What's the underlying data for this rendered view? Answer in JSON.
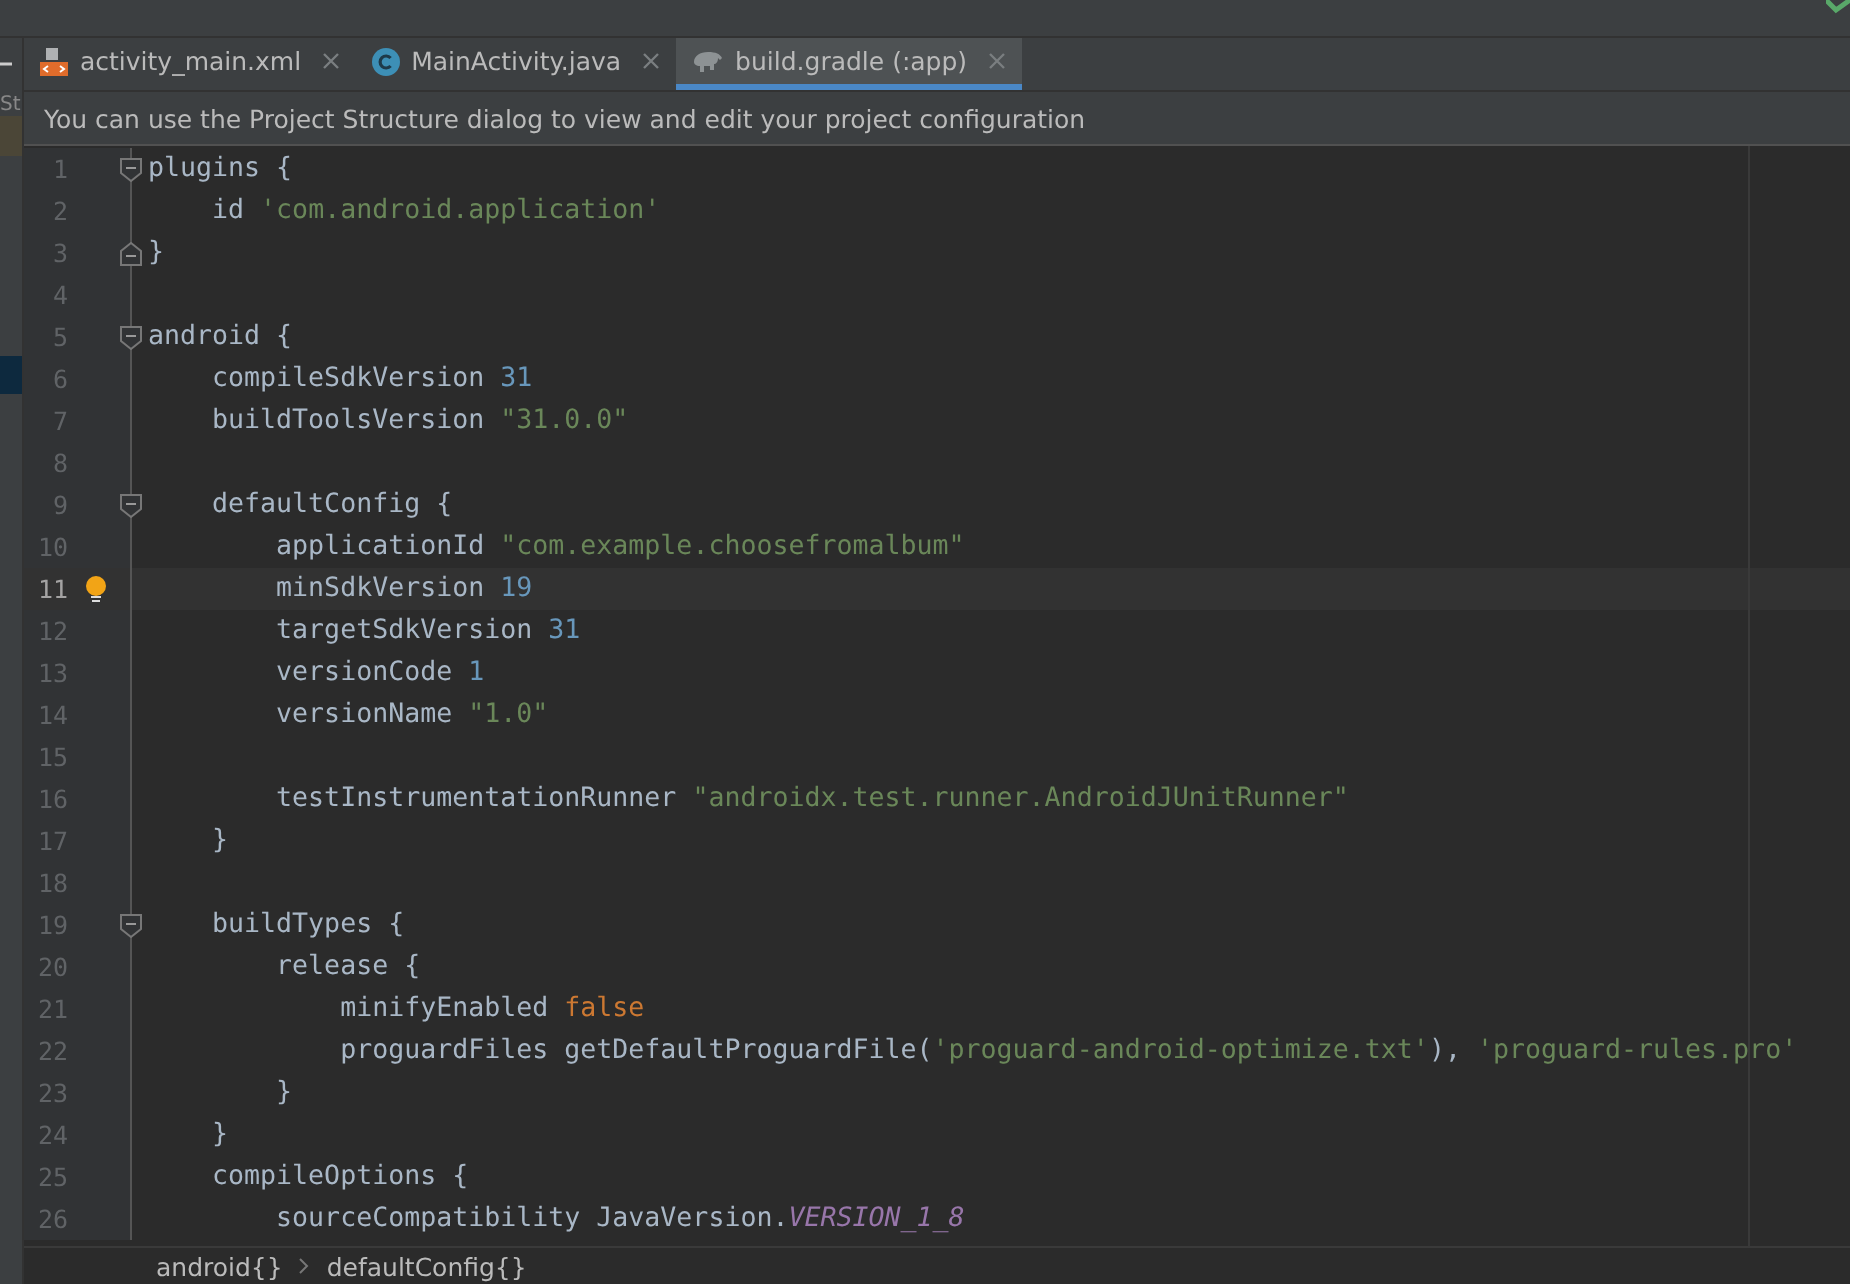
{
  "tabs": [
    {
      "label": "activity_main.xml",
      "kind": "xml",
      "selected": false
    },
    {
      "label": "MainActivity.java",
      "kind": "class",
      "selected": false
    },
    {
      "label": "build.gradle (:app)",
      "kind": "gradle",
      "selected": true
    }
  ],
  "left_panel": {
    "label": "St"
  },
  "notification": {
    "text": "You can use the Project Structure dialog to view and edit your project configuration"
  },
  "lines": [
    {
      "number": "1",
      "kind": "opener",
      "current": false,
      "tokens": [
        {
          "kind": "text",
          "text": "plugins {"
        }
      ]
    },
    {
      "number": "2",
      "kind": "plain",
      "current": false,
      "tokens": [
        {
          "kind": "text",
          "text": "    id "
        },
        {
          "kind": "string",
          "text": "'com.android.application'"
        }
      ]
    },
    {
      "number": "3",
      "kind": "closer",
      "current": false,
      "tokens": [
        {
          "kind": "text",
          "text": "}"
        }
      ]
    },
    {
      "number": "4",
      "kind": "plain",
      "current": false
    },
    {
      "number": "5",
      "kind": "opener",
      "current": false,
      "tokens": [
        {
          "kind": "text",
          "text": "android {"
        }
      ]
    },
    {
      "number": "6",
      "kind": "plain",
      "current": false,
      "tokens": [
        {
          "kind": "text",
          "text": "    compileSdkVersion "
        },
        {
          "kind": "number",
          "text": "31"
        }
      ]
    },
    {
      "number": "7",
      "kind": "plain",
      "current": false,
      "tokens": [
        {
          "kind": "text",
          "text": "    buildToolsVersion "
        },
        {
          "kind": "string",
          "text": "\"31.0.0\""
        }
      ]
    },
    {
      "number": "8",
      "kind": "plain",
      "current": false
    },
    {
      "number": "9",
      "kind": "opener",
      "current": false,
      "tokens": [
        {
          "kind": "text",
          "text": "    defaultConfig {"
        }
      ]
    },
    {
      "number": "10",
      "kind": "plain",
      "current": false,
      "tokens": [
        {
          "kind": "text",
          "text": "        applicationId "
        },
        {
          "kind": "string",
          "text": "\"com.example.choosefromalbum\""
        }
      ]
    },
    {
      "number": "11",
      "kind": "plain",
      "current": true,
      "tokens": [
        {
          "kind": "text",
          "text": "        minSdkVersion "
        },
        {
          "kind": "number",
          "text": "19"
        }
      ]
    },
    {
      "number": "12",
      "kind": "plain",
      "current": false,
      "tokens": [
        {
          "kind": "text",
          "text": "        targetSdkVersion "
        },
        {
          "kind": "number",
          "text": "31"
        }
      ]
    },
    {
      "number": "13",
      "kind": "plain",
      "current": false,
      "tokens": [
        {
          "kind": "text",
          "text": "        versionCode "
        },
        {
          "kind": "number",
          "text": "1"
        }
      ]
    },
    {
      "number": "14",
      "kind": "plain",
      "current": false,
      "tokens": [
        {
          "kind": "text",
          "text": "        versionName "
        },
        {
          "kind": "string",
          "text": "\"1.0\""
        }
      ]
    },
    {
      "number": "15",
      "kind": "plain",
      "current": false
    },
    {
      "number": "16",
      "kind": "plain",
      "current": false,
      "tokens": [
        {
          "kind": "text",
          "text": "        testInstrumentationRunner "
        },
        {
          "kind": "string",
          "text": "\"androidx.test.runner.AndroidJUnitRunner\""
        }
      ]
    },
    {
      "number": "17",
      "kind": "plain",
      "current": false,
      "tokens": [
        {
          "kind": "text",
          "text": "    }"
        }
      ]
    },
    {
      "number": "18",
      "kind": "plain",
      "current": false
    },
    {
      "number": "19",
      "kind": "opener",
      "current": false,
      "tokens": [
        {
          "kind": "text",
          "text": "    buildTypes {"
        }
      ]
    },
    {
      "number": "20",
      "kind": "plain",
      "current": false,
      "tokens": [
        {
          "kind": "text",
          "text": "        release {"
        }
      ]
    },
    {
      "number": "21",
      "kind": "plain",
      "current": false,
      "tokens": [
        {
          "kind": "text",
          "text": "            minifyEnabled "
        },
        {
          "kind": "keyword",
          "text": "false"
        }
      ]
    },
    {
      "number": "22",
      "kind": "plain",
      "current": false,
      "tokens": [
        {
          "kind": "text",
          "text": "            proguardFiles getDefaultProguardFile("
        },
        {
          "kind": "string",
          "text": "'proguard-android-optimize.txt'"
        },
        {
          "kind": "text",
          "text": "), "
        },
        {
          "kind": "string",
          "text": "'proguard-rules.pro'"
        }
      ]
    },
    {
      "number": "23",
      "kind": "plain",
      "current": false,
      "tokens": [
        {
          "kind": "text",
          "text": "        }"
        }
      ]
    },
    {
      "number": "24",
      "kind": "plain",
      "current": false,
      "tokens": [
        {
          "kind": "text",
          "text": "    }"
        }
      ]
    },
    {
      "number": "25",
      "kind": "plain",
      "current": false,
      "tokens": [
        {
          "kind": "text",
          "text": "    compileOptions {"
        }
      ]
    },
    {
      "number": "26",
      "kind": "plain",
      "current": false,
      "tokens": [
        {
          "kind": "text",
          "text": "        sourceCompatibility JavaVersion."
        },
        {
          "kind": "field",
          "text": "VERSION_1_8"
        }
      ]
    }
  ],
  "breadcrumbs": [
    "android{}",
    "defaultConfig{}"
  ]
}
